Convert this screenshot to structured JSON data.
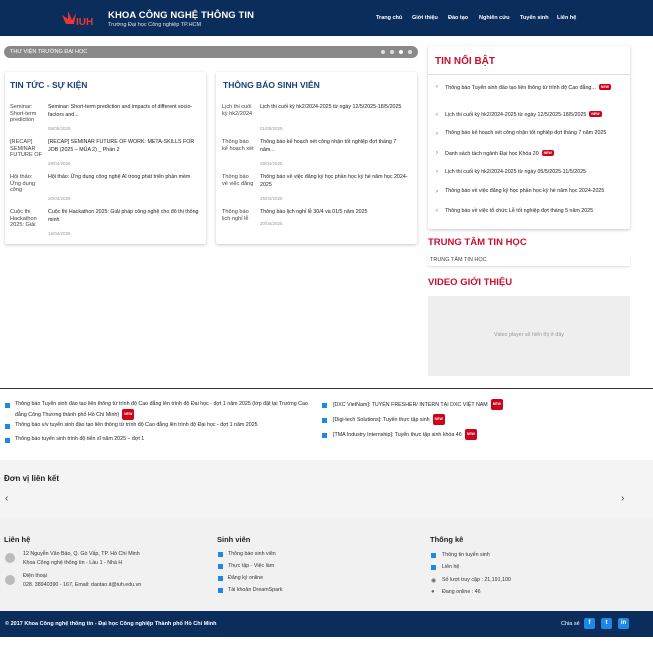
{
  "header": {
    "title": "KHOA CÔNG NGHỆ THÔNG TIN",
    "subtitle": "Trường Đại học Công nghiệp TP.HCM",
    "nav": [
      "Trang chủ",
      "Giới thiệu",
      "Đào tạo",
      "Nghiên cứu",
      "Tuyển sinh",
      "Liên hệ"
    ]
  },
  "slider": {
    "caption": "THƯ VIỆN TRƯỜNG ĐẠI HỌC"
  },
  "news": {
    "title": "TIN TỨC - SỰ KIỆN",
    "items": [
      {
        "img": "Seminar: Short-term prediction",
        "title": "Seminar: Short-term prediction and impacts of different socio-factors and...",
        "date": "05/05/2025"
      },
      {
        "img": "[RECAP] SEMINAR FUTURE OF",
        "title": "[RECAP] SEMINAR FUTURE OF WORK: META-SKILLS FOR JOB (2025 – MÙA 2) _ Phần 2",
        "date": "28/04/2025"
      },
      {
        "img": "Hội thảo: Ứng dụng công",
        "title": "Hội thảo: Ứng dụng công nghệ AI trong phát triển phần mềm",
        "date": "20/04/2025"
      },
      {
        "img": "Cuộc thi Hackathon 2025: Giải",
        "title": "Cuộc thi Hackathon 2025: Giải pháp công nghệ cho đô thị thông minh",
        "date": "15/04/2025"
      }
    ]
  },
  "notices": {
    "title": "THÔNG BÁO SINH VIÊN",
    "items": [
      {
        "img": "Lịch thi cuối kỳ hk2/2024",
        "title": "Lịch thi cuối kỳ hk2/2024-2025 từ ngày 12/5/2025-18/5/2025",
        "date": "01/05/2025"
      },
      {
        "img": "Thông báo kế hoạch xét",
        "title": "Thông báo kế hoạch xét công nhận tốt nghiệp đợt tháng 7 năm...",
        "date": "28/04/2025"
      },
      {
        "img": "Thông báo về việc đăng",
        "title": "Thông báo về việc đăng ký học phần học kỳ hè năm học 2024-2025",
        "date": "25/04/2025"
      },
      {
        "img": "Thông báo lịch nghỉ lễ",
        "title": "Thông báo lịch nghỉ lễ 30/4 và 01/5 năm 2025",
        "date": "20/04/2025"
      }
    ]
  },
  "highlights": {
    "title": "TIN NỔI BẬT",
    "new_label": "NEW",
    "items": [
      {
        "text": "Thông báo Tuyển sinh đào tạo liên thông từ trình độ Cao đẳng...",
        "new": true
      },
      {
        "text": "Lịch thi cuối kỳ hk2/2024-2025 từ ngày 12/5/2025-18/5/2025",
        "new": true
      },
      {
        "text": "Thông báo kế hoạch xét công nhận tốt nghiệp đợt tháng 7 năm 2025",
        "new": false
      },
      {
        "text": "Danh sách tách ngành Đại học Khóa 20",
        "new": true
      },
      {
        "text": "Lịch thi cuối kỳ hk2/2024-2025 từ ngày 05/5/2025-11/5/2025",
        "new": false
      },
      {
        "text": "Thông báo về việc đăng ký học phần học kỳ hè năm học 2024-2025",
        "new": false
      },
      {
        "text": "Thông báo về việc tổ chức Lễ tốt nghiệp đợt tháng 5 năm 2025",
        "new": false
      }
    ]
  },
  "center": {
    "title": "TRUNG TÂM TIN HỌC",
    "image_alt": "TRUNG TÂM TIN HỌC"
  },
  "video": {
    "title": "VIDEO GIỚI THIỆU",
    "placeholder": "Video player sẽ hiển thị ở đây"
  },
  "ticker_left": [
    {
      "text": "Thông báo Tuyển sinh đào tạo liên thông từ trình độ Cao đẳng lên trình độ Đại học - đợt 1 năm 2025 (lớp đặt tại Trường Cao đẳng Công Thương thành phố Hồ Chí Minh)",
      "new": true
    },
    {
      "text": "Thông báo v/v tuyển sinh đào tạo liên thông từ trình độ Cao đẳng lên trình độ Đại học - đợt 1 năm 2025",
      "new": false
    },
    {
      "text": "Thông báo tuyển sinh trình độ tiến sĩ năm 2025 – đợt 1",
      "new": false
    }
  ],
  "ticker_right": [
    {
      "text": "[DXC VietNam]: TUYỂN FRESHER/ INTERN TẠI DXC VIỆT NAM",
      "new": true
    },
    {
      "text": "[Digi-tech Solutions]: Tuyển thực tập sinh",
      "new": true
    },
    {
      "text": "[TMA Industry Internship]: Tuyển thực tập sinh khóa 46",
      "new": true
    }
  ],
  "partners": {
    "title": "Đơn vị liên kết"
  },
  "footer": {
    "contact": {
      "title": "Liên hệ",
      "address1": "12 Nguyễn Văn Bảo, Q. Gò Vấp, TP. Hồ Chí Minh",
      "address2": "Khoa Công nghệ thông tin - Lầu 1 - Nhà H",
      "phone_label": "Điện thoại",
      "phone": "028. 38940390 - 167, Email: daotao.it@iuh.edu.vn"
    },
    "students": {
      "title": "Sinh viên",
      "links": [
        "Thông báo sinh viên",
        "Thực tập - Việc làm",
        "Đăng ký online",
        "Tài khoản DreamSpark"
      ]
    },
    "stats": {
      "title": "Thống kê",
      "links": [
        "Thông tin tuyển sinh",
        "Liên hệ"
      ],
      "visits": "Số lượt truy cập : 21,191,100",
      "online": "Đang online : 46"
    }
  },
  "bottom": {
    "copyright": "© 2017 Khoa Công nghệ thông tin - Đại học Công nghiệp Thành phố Hồ Chí Minh",
    "share_label": "Chia sẻ",
    "social": [
      "f",
      "t",
      "in"
    ]
  }
}
